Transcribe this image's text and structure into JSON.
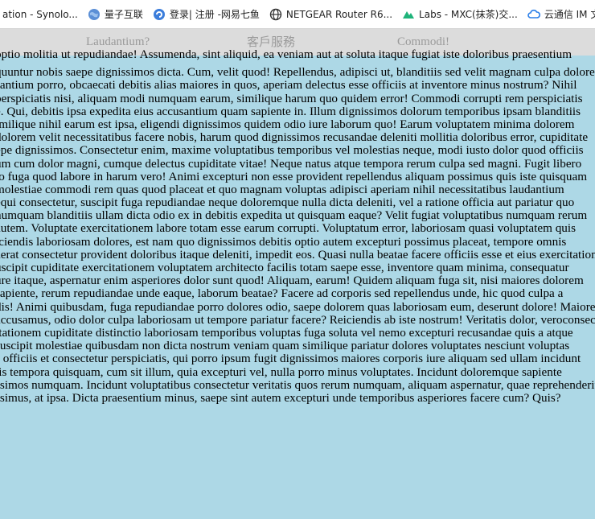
{
  "bookmarks": [
    {
      "label": "ation - Synolo...",
      "icon": "none"
    },
    {
      "label": "量子互联",
      "icon": "globe-icon"
    },
    {
      "label": "登录| 注册 -网易七鱼",
      "icon": "refresh-icon"
    },
    {
      "label": "NETGEAR Router R6...",
      "icon": "world-icon"
    },
    {
      "label": "Labs - MXC(抹茶)交...",
      "icon": "mountain-icon"
    },
    {
      "label": "云通信 IM 文",
      "icon": "cloud-icon"
    }
  ],
  "nav": {
    "items": [
      "Laudantium?",
      "客戶服務",
      "Commodi!"
    ]
  },
  "content": {
    "lines": [
      "optio molitia ut repudiandae! Assumenda, sint aliquid, ea veniam aut at soluta itaque fugiat iste doloribus praesentium",
      "quuntur nobis saepe dignissimos dicta. Cum, velit quod! Repellendus, adipisci ut, blanditiis sed velit magnam culpa doloremque",
      "santium porro, obcaecati debitis alias maiores in quos, aperiam delectus esse officiis at inventore minus nostrum? Nihil",
      " perspiciatis nisi, aliquam modi numquam earum, similique harum quo quidem error! Commodi corrupti rem perspiciatis",
      "e. Qui, debitis ipsa expedita eius accusantium quam sapiente in. Illum dignissimos dolorum temporibus ipsam blanditiis",
      "imilique nihil earum est ipsa, eligendi dignissimos quidem odio iure laborum quo! Earum voluptatem minima dolorem",
      " dolorem velit necessitatibus facere nobis, harum quod dignissimos recusandae deleniti mollitia doloribus error, cupiditate",
      "epe dignissimos. Consectetur enim, maxime voluptatibus temporibus vel molestias neque, modi iusto dolor quod officiis",
      "um cum dolor magni, cumque delectus cupiditate vitae! Neque natus atque tempora rerum culpa sed magni. Fugit libero",
      "lo fuga quod labore in harum vero! Animi excepturi non esse provident repellendus aliquam possimus quis iste quisquam",
      "molestiae commodi rem quas quod placeat et quo magnam voluptas adipisci aperiam nihil necessitatibus laudantium",
      "equi consectetur, suscipit fuga repudiandae neque doloremque nulla dicta deleniti, vel a ratione officia aut pariatur quo",
      "numquam blanditiis ullam dicta odio ex in debitis expedita ut quisquam eaque? Velit fugiat voluptatibus numquam rerum",
      "autem. Voluptate exercitationem labore totam esse earum corrupti. Voluptatum error, laboriosam quasi voluptatem quis",
      "iciendis laboriosam dolores, est nam quo dignissimos debitis optio autem excepturi possimus placeat, tempore omnis",
      "aerat consectetur provident doloribus itaque deleniti, impedit eos. Quasi nulla beatae facere officiis esse et eius exercitationem",
      "uscipit cupiditate exercitationem voluptatem architecto facilis totam saepe esse, inventore quam minima, consequatur",
      "ure itaque, aspernatur enim asperiores dolor sunt quod! Aliquam, earum! Quidem aliquam fuga sit, nisi maiores dolorem",
      "sapiente, rerum repudiandae unde eaque, laborum beatae? Facere ad corporis sed repellendus unde, hic quod culpa a",
      "dis! Animi quibusdam, fuga repudiandae porro dolores odio, saepe dolorem quas laboriosam eum, deserunt dolore! Maiores",
      "accusamus, odio dolor culpa laboriosam ut tempore pariatur facere? Reiciendis ab iste nostrum! Veritatis dolor, veroconsectetur",
      "itationem cupiditate distinctio laboriosam temporibus voluptas fuga soluta vel nemo excepturi recusandae quis a atque",
      " suscipit molestiae quibusdam non dicta nostrum veniam quam similique pariatur dolores voluptates nesciunt voluptas",
      "s officiis et consectetur perspiciatis, qui porro ipsum fugit dignissimos maiores corporis iure aliquam sed ullam incidunt",
      "lis tempora quisquam, cum sit illum, quia excepturi vel, nulla porro minus voluptates. Incidunt doloremque sapiente",
      "ssimos numquam. Incidunt voluptatibus consectetur veritatis quos rerum numquam, aliquam aspernatur, quae reprehenderit",
      "ssimus, at ipsa. Dicta praesentium minus, saepe sint autem excepturi unde temporibus asperiores facere cum? Quis?"
    ]
  },
  "colors": {
    "page_background": "#add8e6",
    "nav_background": "#dcdcdc",
    "nav_text": "#9a9a9a",
    "body_text": "#000000"
  }
}
